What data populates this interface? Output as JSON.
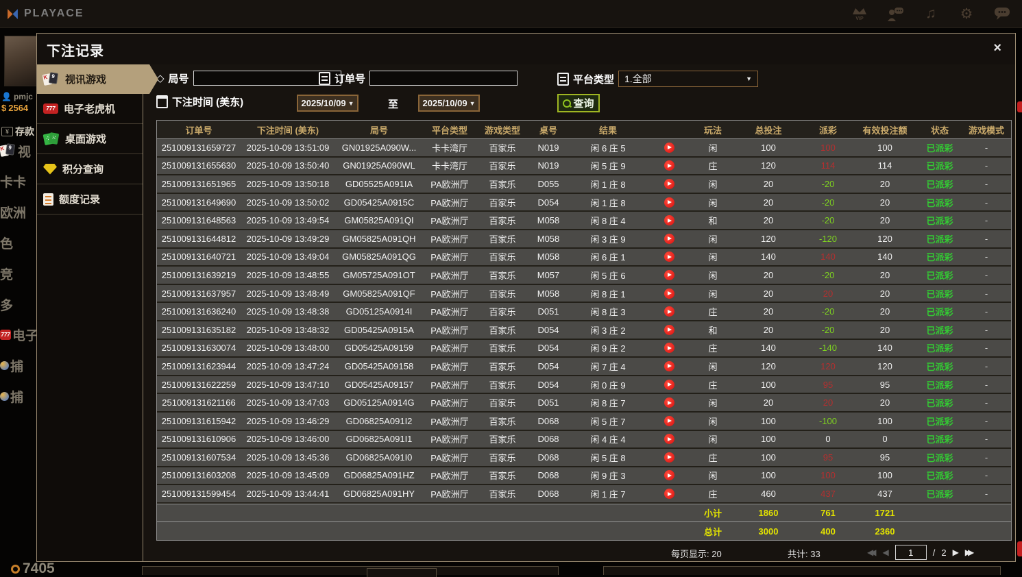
{
  "topbar": {
    "brand": "PLAYACE",
    "icons": [
      "vip-icon",
      "support-icon",
      "music-icon",
      "settings-icon",
      "chat-icon"
    ]
  },
  "lobby": {
    "username": "pmjc",
    "balance": "2564",
    "deposit_label": "存款",
    "menu": [
      {
        "label": "视",
        "icon": "cards-icon"
      },
      {
        "label": "卡卡",
        "icon": ""
      },
      {
        "label": "欧洲",
        "icon": ""
      },
      {
        "label": "色",
        "icon": ""
      },
      {
        "label": "竞",
        "icon": ""
      },
      {
        "label": "多",
        "icon": ""
      },
      {
        "label": "电子",
        "icon": "slot-icon"
      },
      {
        "label": "捕",
        "icon": "fish-icon"
      },
      {
        "label": "捕",
        "icon": "fish-icon"
      }
    ],
    "chips": "7405"
  },
  "modal": {
    "title": "下注记录",
    "close": "×"
  },
  "sidebar": {
    "items": [
      {
        "label": "视讯游戏",
        "icon": "video-cards-icon",
        "selected": true
      },
      {
        "label": "电子老虎机",
        "icon": "slot-777-icon",
        "selected": false
      },
      {
        "label": "桌面游戏",
        "icon": "table-games-icon",
        "selected": false
      },
      {
        "label": "积分查询",
        "icon": "points-gem-icon",
        "selected": false
      },
      {
        "label": "额度记录",
        "icon": "quota-doc-icon",
        "selected": false
      }
    ]
  },
  "filters": {
    "round_label": "局号",
    "round_value": "",
    "round_placeholder": "",
    "order_label": "订单号",
    "order_value": "",
    "order_placeholder": "",
    "platform_label": "平台类型",
    "platform_value": "1.全部",
    "platform_arrow": "▼",
    "time_label": "下注时间 (美东)",
    "date_from": "2025/10/09",
    "to_label": "至",
    "date_to": "2025/10/09",
    "date_arrow": "▼",
    "query_label": "查询"
  },
  "table": {
    "headers": [
      "订单号",
      "下注时间 (美东)",
      "局号",
      "平台类型",
      "游戏类型",
      "桌号",
      "结果",
      "玩法",
      "总投注",
      "派彩",
      "有效投注额",
      "状态",
      "游戏模式"
    ],
    "rows": [
      {
        "order": "251009131659727",
        "time": "2025-10-09 13:51:09",
        "round": "GN01925A090W...",
        "platform": "卡卡湾厅",
        "game": "百家乐",
        "table": "N019",
        "result": "闲 6 庄 5",
        "play": "闲",
        "bet": "100",
        "payout": "100",
        "valid": "100",
        "status": "已派彩",
        "mode": "-"
      },
      {
        "order": "251009131655630",
        "time": "2025-10-09 13:50:40",
        "round": "GN01925A090WL",
        "platform": "卡卡湾厅",
        "game": "百家乐",
        "table": "N019",
        "result": "闲 5 庄 9",
        "play": "庄",
        "bet": "120",
        "payout": "114",
        "valid": "114",
        "status": "已派彩",
        "mode": "-"
      },
      {
        "order": "251009131651965",
        "time": "2025-10-09 13:50:18",
        "round": "GD05525A091IA",
        "platform": "PA欧洲厅",
        "game": "百家乐",
        "table": "D055",
        "result": "闲 1 庄 8",
        "play": "闲",
        "bet": "20",
        "payout": "-20",
        "valid": "20",
        "status": "已派彩",
        "mode": "-"
      },
      {
        "order": "251009131649690",
        "time": "2025-10-09 13:50:02",
        "round": "GD05425A0915C",
        "platform": "PA欧洲厅",
        "game": "百家乐",
        "table": "D054",
        "result": "闲 1 庄 8",
        "play": "闲",
        "bet": "20",
        "payout": "-20",
        "valid": "20",
        "status": "已派彩",
        "mode": "-"
      },
      {
        "order": "251009131648563",
        "time": "2025-10-09 13:49:54",
        "round": "GM05825A091QI",
        "platform": "PA欧洲厅",
        "game": "百家乐",
        "table": "M058",
        "result": "闲 8 庄 4",
        "play": "和",
        "bet": "20",
        "payout": "-20",
        "valid": "20",
        "status": "已派彩",
        "mode": "-"
      },
      {
        "order": "251009131644812",
        "time": "2025-10-09 13:49:29",
        "round": "GM05825A091QH",
        "platform": "PA欧洲厅",
        "game": "百家乐",
        "table": "M058",
        "result": "闲 3 庄 9",
        "play": "闲",
        "bet": "120",
        "payout": "-120",
        "valid": "120",
        "status": "已派彩",
        "mode": "-"
      },
      {
        "order": "251009131640721",
        "time": "2025-10-09 13:49:04",
        "round": "GM05825A091QG",
        "platform": "PA欧洲厅",
        "game": "百家乐",
        "table": "M058",
        "result": "闲 6 庄 1",
        "play": "闲",
        "bet": "140",
        "payout": "140",
        "valid": "140",
        "status": "已派彩",
        "mode": "-"
      },
      {
        "order": "251009131639219",
        "time": "2025-10-09 13:48:55",
        "round": "GM05725A091OT",
        "platform": "PA欧洲厅",
        "game": "百家乐",
        "table": "M057",
        "result": "闲 5 庄 6",
        "play": "闲",
        "bet": "20",
        "payout": "-20",
        "valid": "20",
        "status": "已派彩",
        "mode": "-"
      },
      {
        "order": "251009131637957",
        "time": "2025-10-09 13:48:49",
        "round": "GM05825A091QF",
        "platform": "PA欧洲厅",
        "game": "百家乐",
        "table": "M058",
        "result": "闲 8 庄 1",
        "play": "闲",
        "bet": "20",
        "payout": "20",
        "valid": "20",
        "status": "已派彩",
        "mode": "-"
      },
      {
        "order": "251009131636240",
        "time": "2025-10-09 13:48:38",
        "round": "GD05125A0914I",
        "platform": "PA欧洲厅",
        "game": "百家乐",
        "table": "D051",
        "result": "闲 8 庄 3",
        "play": "庄",
        "bet": "20",
        "payout": "-20",
        "valid": "20",
        "status": "已派彩",
        "mode": "-"
      },
      {
        "order": "251009131635182",
        "time": "2025-10-09 13:48:32",
        "round": "GD05425A0915A",
        "platform": "PA欧洲厅",
        "game": "百家乐",
        "table": "D054",
        "result": "闲 3 庄 2",
        "play": "和",
        "bet": "20",
        "payout": "-20",
        "valid": "20",
        "status": "已派彩",
        "mode": "-"
      },
      {
        "order": "251009131630074",
        "time": "2025-10-09 13:48:00",
        "round": "GD05425A09159",
        "platform": "PA欧洲厅",
        "game": "百家乐",
        "table": "D054",
        "result": "闲 9 庄 2",
        "play": "庄",
        "bet": "140",
        "payout": "-140",
        "valid": "140",
        "status": "已派彩",
        "mode": "-"
      },
      {
        "order": "251009131623944",
        "time": "2025-10-09 13:47:24",
        "round": "GD05425A09158",
        "platform": "PA欧洲厅",
        "game": "百家乐",
        "table": "D054",
        "result": "闲 7 庄 4",
        "play": "闲",
        "bet": "120",
        "payout": "120",
        "valid": "120",
        "status": "已派彩",
        "mode": "-"
      },
      {
        "order": "251009131622259",
        "time": "2025-10-09 13:47:10",
        "round": "GD05425A09157",
        "platform": "PA欧洲厅",
        "game": "百家乐",
        "table": "D054",
        "result": "闲 0 庄 9",
        "play": "庄",
        "bet": "100",
        "payout": "95",
        "valid": "95",
        "status": "已派彩",
        "mode": "-"
      },
      {
        "order": "251009131621166",
        "time": "2025-10-09 13:47:03",
        "round": "GD05125A0914G",
        "platform": "PA欧洲厅",
        "game": "百家乐",
        "table": "D051",
        "result": "闲 8 庄 7",
        "play": "闲",
        "bet": "20",
        "payout": "20",
        "valid": "20",
        "status": "已派彩",
        "mode": "-"
      },
      {
        "order": "251009131615942",
        "time": "2025-10-09 13:46:29",
        "round": "GD06825A091I2",
        "platform": "PA欧洲厅",
        "game": "百家乐",
        "table": "D068",
        "result": "闲 5 庄 7",
        "play": "闲",
        "bet": "100",
        "payout": "-100",
        "valid": "100",
        "status": "已派彩",
        "mode": "-"
      },
      {
        "order": "251009131610906",
        "time": "2025-10-09 13:46:00",
        "round": "GD06825A091I1",
        "platform": "PA欧洲厅",
        "game": "百家乐",
        "table": "D068",
        "result": "闲 4 庄 4",
        "play": "闲",
        "bet": "100",
        "payout": "0",
        "valid": "0",
        "status": "已派彩",
        "mode": "-"
      },
      {
        "order": "251009131607534",
        "time": "2025-10-09 13:45:36",
        "round": "GD06825A091I0",
        "platform": "PA欧洲厅",
        "game": "百家乐",
        "table": "D068",
        "result": "闲 5 庄 8",
        "play": "庄",
        "bet": "100",
        "payout": "95",
        "valid": "95",
        "status": "已派彩",
        "mode": "-"
      },
      {
        "order": "251009131603208",
        "time": "2025-10-09 13:45:09",
        "round": "GD06825A091HZ",
        "platform": "PA欧洲厅",
        "game": "百家乐",
        "table": "D068",
        "result": "闲 9 庄 3",
        "play": "闲",
        "bet": "100",
        "payout": "100",
        "valid": "100",
        "status": "已派彩",
        "mode": "-"
      },
      {
        "order": "251009131599454",
        "time": "2025-10-09 13:44:41",
        "round": "GD06825A091HY",
        "platform": "PA欧洲厅",
        "game": "百家乐",
        "table": "D068",
        "result": "闲 1 庄 7",
        "play": "庄",
        "bet": "460",
        "payout": "437",
        "valid": "437",
        "status": "已派彩",
        "mode": "-"
      }
    ],
    "subtotal": {
      "label": "小计",
      "bet": "1860",
      "payout": "761",
      "valid": "1721"
    },
    "total": {
      "label": "总计",
      "bet": "3000",
      "payout": "400",
      "valid": "2360"
    }
  },
  "footer": {
    "per_page": "每页显示: 20",
    "total_count": "共计: 33",
    "page": "1",
    "page_sep": "/",
    "page_count": "2"
  },
  "colors": {
    "accent_gold": "#c9a96a",
    "selected_tab_beige": "#b4a07c",
    "win_red": "#b52f2f",
    "loss_green": "#7fd420",
    "paid_status_green": "#33cc33",
    "summary_yellow": "#e3e300",
    "query_border_green": "#9fb622",
    "date_border_orange": "#8a6538",
    "balance_orange": "#e8a33d"
  }
}
